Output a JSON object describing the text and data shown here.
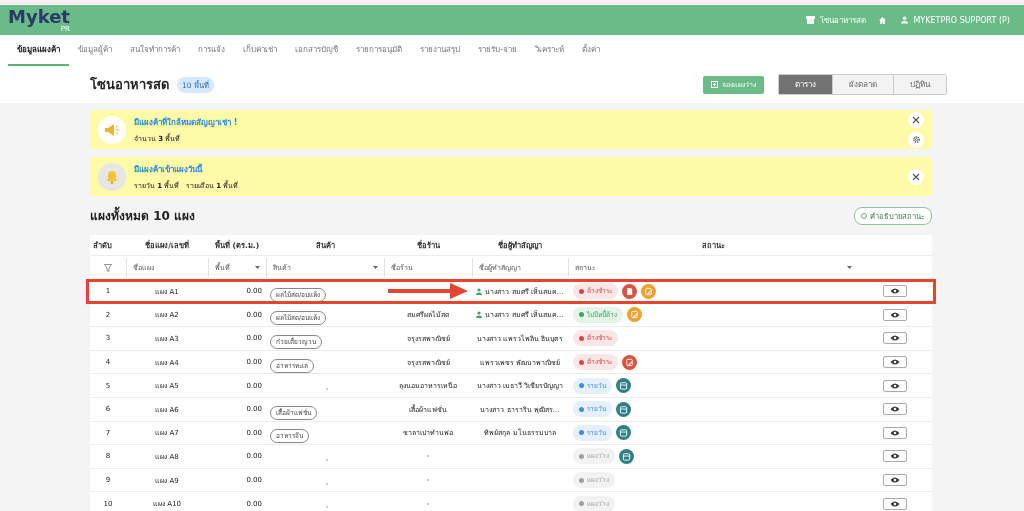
{
  "header": {
    "logo": "Myket",
    "logo_sub": "PR",
    "zone": "โซนอาหารสด",
    "user": "MYKETPRO SUPPORT (P)"
  },
  "nav": [
    {
      "label": "ข้อมูลแผงค้า",
      "selected": true
    },
    {
      "label": "ข้อมูลผู้ค้า",
      "selected": false
    },
    {
      "label": "สนใจทำการค้า",
      "selected": false
    },
    {
      "label": "การแจ้ง",
      "selected": false
    },
    {
      "label": "เก็บค่าเช่า",
      "selected": false
    },
    {
      "label": "เอกสารบัญชี",
      "selected": false
    },
    {
      "label": "รายการอนุมัติ",
      "selected": false
    },
    {
      "label": "รายงานสรุป",
      "selected": false
    },
    {
      "label": "รายรับ-จ่าย",
      "selected": false
    },
    {
      "label": "วิเคราะห์",
      "selected": false
    },
    {
      "label": "ตั้งค่า",
      "selected": false
    }
  ],
  "page": {
    "title": "โซนอาหารสด",
    "badge": "10 พื้นที่",
    "book_button": "จองแผงว่าง",
    "views": [
      {
        "label": "ตาราง",
        "selected": true
      },
      {
        "label": "ผังตลาด",
        "selected": false
      },
      {
        "label": "ปฏิทิน",
        "selected": false
      }
    ]
  },
  "alerts": [
    {
      "kind": "megaphone",
      "title": "มีแผงค้าที่ใกล้หมดสัญญาเช่า !",
      "detail": "จำนวน **3** พื้นที่",
      "settings": true
    },
    {
      "kind": "bell",
      "title": "มีแผงค้าเข้าแผงวันนี้",
      "detail": "รายวัน **1** พื้นที่   รายเดือน **1** พื้นที่",
      "settings": false
    }
  ],
  "section": {
    "title": "แผงทั้งหมด 10 แผง",
    "legend_button": "คำอธิบายสถานะ"
  },
  "table": {
    "columns": [
      "ลำดับ",
      "ชื่อแผง/เลขที่",
      "พื้นที่ (ตร.ม.)",
      "สินค้า",
      "ชื่อร้าน",
      "ชื่อผู้ทำสัญญา",
      "สถานะ"
    ],
    "filters": [
      {
        "placeholder": "ชื่อแผง",
        "dropdown": false
      },
      {
        "placeholder": "พื้นที่",
        "dropdown": true
      },
      {
        "placeholder": "สินค้า",
        "dropdown": true
      },
      {
        "placeholder": "ชื่อร้าน",
        "dropdown": false
      },
      {
        "placeholder": "ชื่อผู้ทำสัญญา",
        "dropdown": false
      },
      {
        "placeholder": "สถานะ",
        "dropdown": true
      }
    ],
    "rows": [
      {
        "no": "1",
        "name": "แผง A1",
        "area": "0.00",
        "product": "ผลไม้สด/อบแห้ง",
        "shop": "",
        "contract": "นางสาว สมศรี เห็นสมค...",
        "status": {
          "label": "ค้างชำระ",
          "color": "#d64545"
        },
        "icons": [
          {
            "kind": "document"
          },
          {
            "kind": "edit-orange"
          }
        ],
        "highlighted": true,
        "contract_verified": true
      },
      {
        "no": "2",
        "name": "แผง A2",
        "area": "0.00",
        "product": "ผลไม้สด/อบแห้ง",
        "shop": "สมศรีผลไม้สด",
        "contract": "นางสาว สมศรี เห็นสมค...",
        "status": {
          "label": "ไม่มีหนี้ค้าง",
          "color": "#3aa857"
        },
        "icons": [
          {
            "kind": "edit-orange"
          }
        ],
        "highlighted": false,
        "contract_verified": true
      },
      {
        "no": "3",
        "name": "แผง A3",
        "area": "0.00",
        "product": "ก๋วยเตี๋ยวญวน",
        "shop": "จรุงรสพาณิชย์",
        "contract": "นางสาว แพรวไพลิน ธินบุตร",
        "status": {
          "label": "ค้างชำระ",
          "color": "#d64545"
        },
        "icons": [],
        "highlighted": false
      },
      {
        "no": "4",
        "name": "แผง A4",
        "area": "0.00",
        "product": "อาหารทะเล",
        "shop": "จรุงรสพาณิชย์",
        "contract": "แพรวเพชร พัฒนาพาณิชย์",
        "status": {
          "label": "ค้างชำระ",
          "color": "#d64545"
        },
        "icons": [
          {
            "kind": "edit-red"
          }
        ],
        "highlighted": false
      },
      {
        "no": "5",
        "name": "แผง A5",
        "area": "0.00",
        "product": "-",
        "shop": "ลุงนอมอาหารเหนือ",
        "contract": "นางสาว เมธาวี วิเชียรปัญญา",
        "status": {
          "label": "รายวัน",
          "color": "#3b8fe0"
        },
        "icons": [
          {
            "kind": "calendar"
          }
        ],
        "highlighted": false
      },
      {
        "no": "6",
        "name": "แผง A6",
        "area": "0.00",
        "product": "เสื้อผ้าแฟชั่น",
        "shop": "เสื้อผ้าแฟชั่น",
        "contract": "นางสาว ธาราริน พุฒิสร...",
        "status": {
          "label": "รายวัน",
          "color": "#3b8fe0"
        },
        "icons": [
          {
            "kind": "calendar"
          }
        ],
        "highlighted": false
      },
      {
        "no": "7",
        "name": "แผง A7",
        "area": "0.00",
        "product": "อาหารจีน",
        "shop": "ชาลาเปาทำนพ่อ",
        "contract": "ทิพย์สกุล มโนธรรมบาล",
        "status": {
          "label": "รายวัน",
          "color": "#3b8fe0"
        },
        "icons": [
          {
            "kind": "calendar"
          }
        ],
        "highlighted": false
      },
      {
        "no": "8",
        "name": "แผง A8",
        "area": "0.00",
        "product": "-",
        "shop": "-",
        "contract": "",
        "status": {
          "label": "แผงว่าง",
          "color": "#a0a0a0"
        },
        "icons": [
          {
            "kind": "calendar"
          }
        ],
        "highlighted": false
      },
      {
        "no": "9",
        "name": "แผง A9",
        "area": "0.00",
        "product": "-",
        "shop": "-",
        "contract": "",
        "status": {
          "label": "แผงว่าง",
          "color": "#a0a0a0"
        },
        "icons": [],
        "highlighted": false
      },
      {
        "no": "10",
        "name": "แผง A10",
        "area": "0.00",
        "product": "-",
        "shop": "-",
        "contract": "",
        "status": {
          "label": "แผงว่าง",
          "color": "#a0a0a0"
        },
        "icons": [],
        "highlighted": false
      }
    ]
  }
}
